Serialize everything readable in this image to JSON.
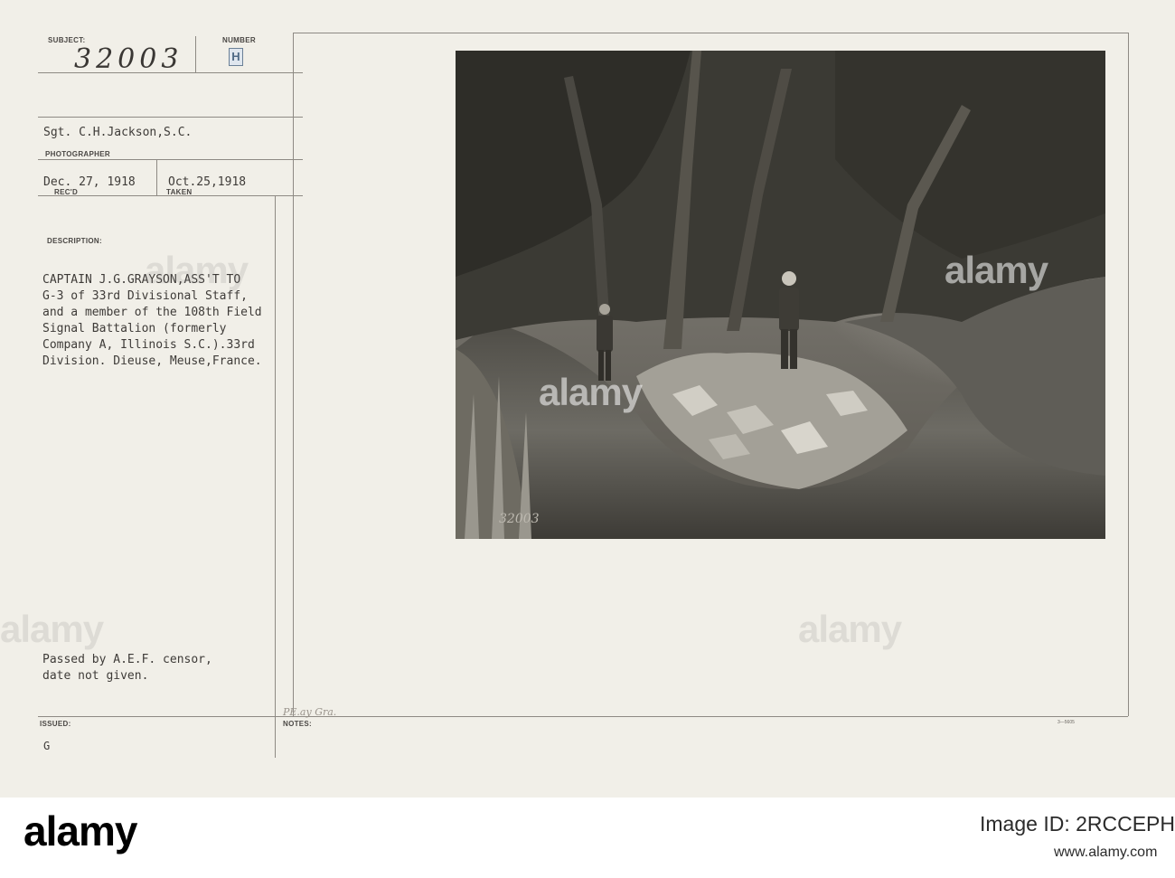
{
  "card": {
    "labels": {
      "subject": "SUBJECT:",
      "number": "NUMBER",
      "photographer": "PHOTOGRAPHER",
      "recd": "REC'D",
      "taken": "TAKEN",
      "description": "DESCRIPTION:",
      "issued": "ISSUED:",
      "notes": "NOTES:"
    },
    "subject_number": "32003",
    "number_stamp": "H",
    "photographer": "Sgt. C.H.Jackson,S.C.",
    "date_received": "Dec. 27, 1918",
    "date_taken": "Oct.25,1918",
    "description_lines": [
      "CAPTAIN J.G.GRAYSON,ASS'T TO",
      "G-3 of 33rd Divisional Staff,",
      "and a member of the 108th Field",
      "Signal Battalion (formerly",
      "Company A, Illinois S.C.).33rd",
      "Division. Dieuse, Meuse,France."
    ],
    "censor_lines": [
      "Passed by A.E.F. censor,",
      "date not given."
    ],
    "issued_value": "G",
    "notes_handwriting": "PE.ay Gra.",
    "photo_number": "32003",
    "form_code": "3—5605"
  },
  "watermark": "alamy",
  "footer": {
    "logo": "alamy",
    "image_id": "Image ID: 2RCCEPH",
    "url": "www.alamy.com"
  }
}
